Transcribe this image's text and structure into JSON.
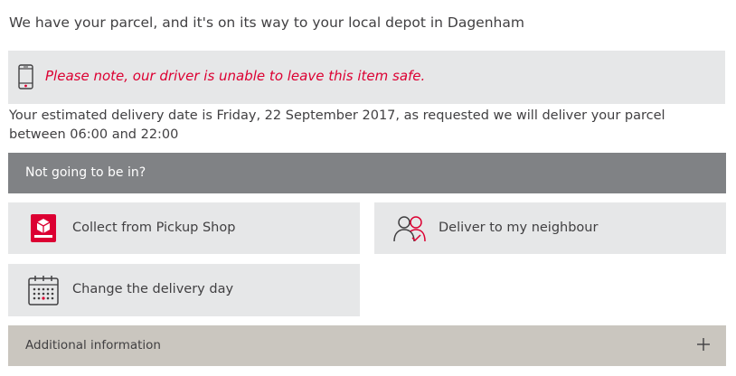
{
  "status_heading": "We have your parcel, and it's on its way to your local depot in Dagenham",
  "notice": {
    "icon": "mobile-phone-icon",
    "text": "Please note, our driver is unable to leave this item safe."
  },
  "estimate_text": "Your estimated delivery date is Friday, 22 September 2017, as requested we will deliver your parcel between 06:00 and 22:00",
  "not_in": {
    "label": "Not going to be in?"
  },
  "options": {
    "pickup": {
      "label": "Collect from Pickup Shop",
      "icon": "pickup-shop-icon"
    },
    "neighbour": {
      "label": "Deliver to my neighbour",
      "icon": "neighbour-icon"
    },
    "change_day": {
      "label": "Change the delivery day",
      "icon": "calendar-icon"
    }
  },
  "additional": {
    "label": "Additional information",
    "icon": "plus-icon"
  },
  "colors": {
    "brand_red": "#dc0032",
    "panel_grey": "#e6e7e8",
    "bar_grey": "#808285",
    "additional_beige": "#cac6bf",
    "text": "#414042"
  }
}
